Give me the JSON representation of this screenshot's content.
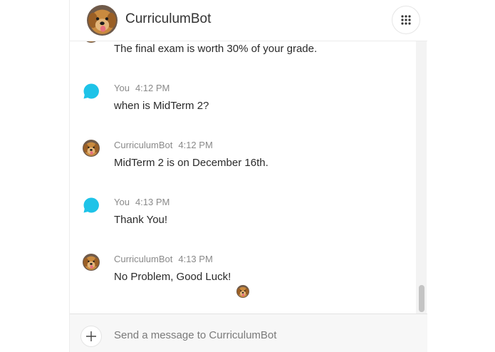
{
  "header": {
    "title": "CurriculumBot",
    "avatar_icon": "golden-retriever-avatar-icon",
    "apps_icon": "apps-grid-icon"
  },
  "messages": [
    {
      "sender": "",
      "time": "",
      "text": "The final exam is worth 30% of your grade.",
      "avatar": "bot"
    },
    {
      "sender": "You",
      "time": "4:12 PM",
      "text": "when is MidTerm 2?",
      "avatar": "user"
    },
    {
      "sender": "CurriculumBot",
      "time": "4:12 PM",
      "text": "MidTerm 2 is on December 16th.",
      "avatar": "bot"
    },
    {
      "sender": "You",
      "time": "4:13 PM",
      "text": "Thank You!",
      "avatar": "user"
    },
    {
      "sender": "CurriculumBot",
      "time": "4:13 PM",
      "text": "No Problem, Good Luck!",
      "avatar": "bot"
    }
  ],
  "composer": {
    "placeholder": "Send a message to CurriculumBot",
    "add_icon": "plus-icon"
  },
  "colors": {
    "user_bubble": "#1ec3e8",
    "meta_text": "#8a8a8a",
    "dog_fur": "#c98a3f"
  }
}
